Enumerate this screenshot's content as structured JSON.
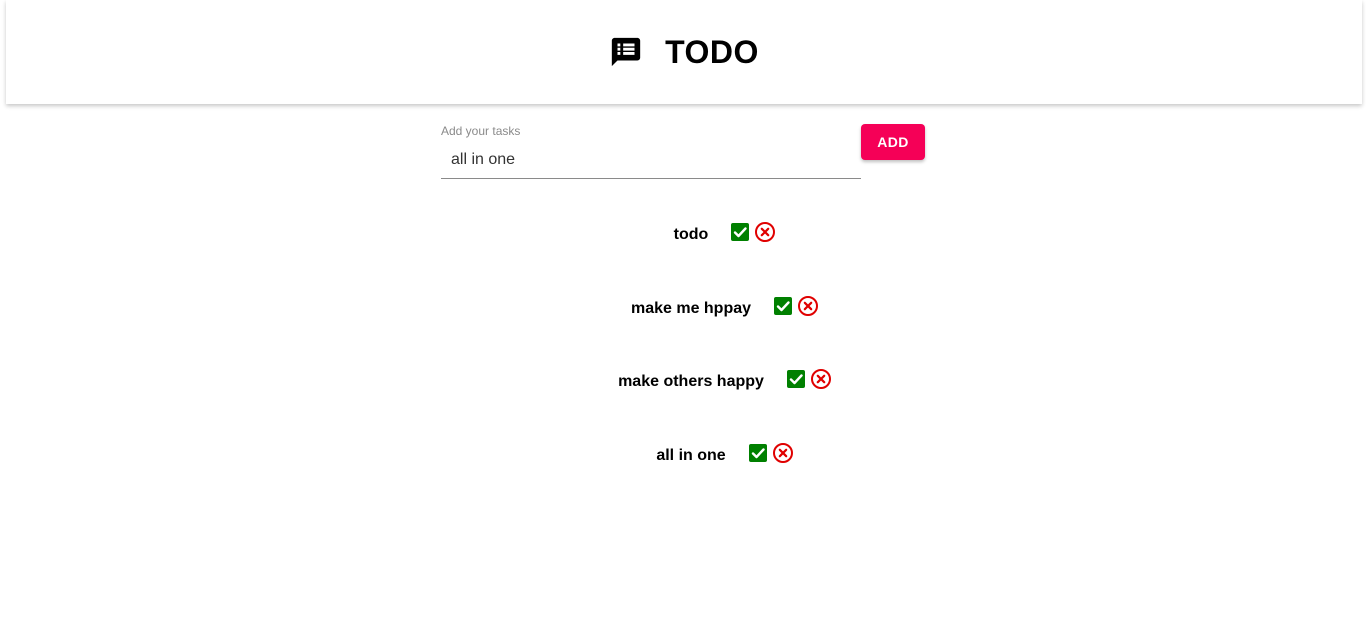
{
  "app": {
    "title": "TODO",
    "icon": "message-list-icon"
  },
  "form": {
    "label": "Add your tasks",
    "value": "all in one",
    "add_label": "ADD"
  },
  "colors": {
    "accent": "#f50057",
    "check": "#008000",
    "delete": "#e00000"
  },
  "todos": [
    {
      "text": "todo"
    },
    {
      "text": "make me hppay"
    },
    {
      "text": "make others happy"
    },
    {
      "text": "all in one"
    }
  ]
}
